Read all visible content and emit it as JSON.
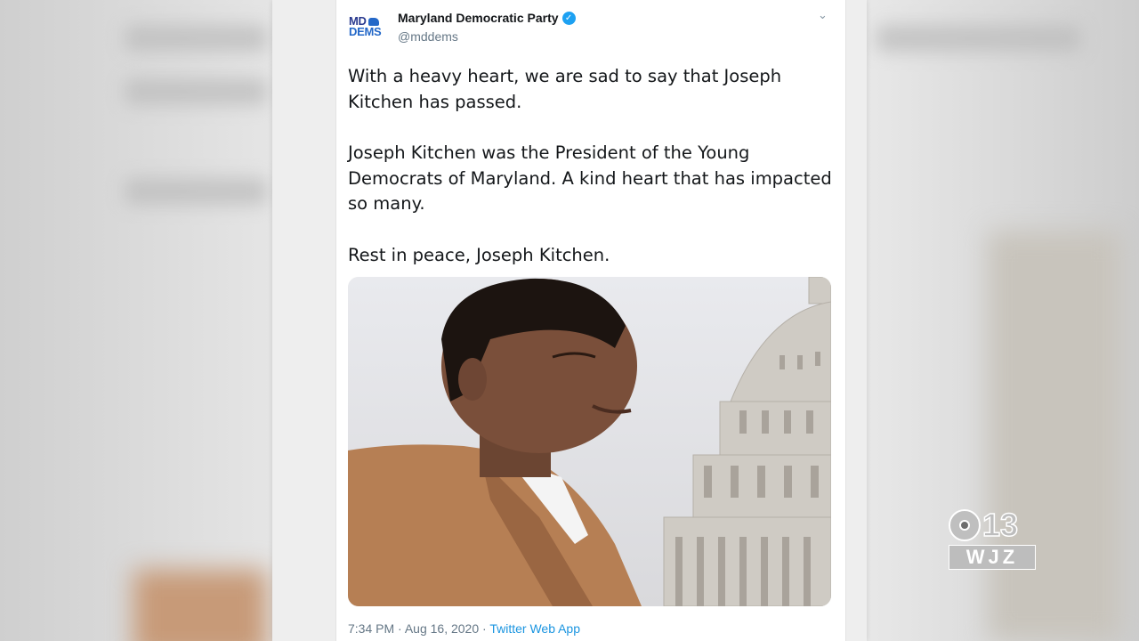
{
  "account": {
    "avatar_line1": "MD",
    "avatar_line2": "DEMS",
    "name": "Maryland Democratic Party",
    "handle": "@mddems",
    "verified_icon": "verified-check-icon"
  },
  "tweet": {
    "paragraphs": [
      "With a heavy heart, we are sad to say that Joseph Kitchen has passed.",
      "Joseph Kitchen was the President of the Young Democrats of Maryland. A kind heart that has impacted so many.",
      "Rest in peace, Joseph Kitchen."
    ],
    "time": "7:34 PM",
    "date": "Aug 16, 2020",
    "separator": "·",
    "source": "Twitter Web App"
  },
  "station_logo": {
    "channel": "13",
    "callsign": "WJZ"
  },
  "colors": {
    "link": "#1b95e0",
    "verified": "#1da1f2",
    "text": "#14171a",
    "secondary_text": "#657786"
  }
}
